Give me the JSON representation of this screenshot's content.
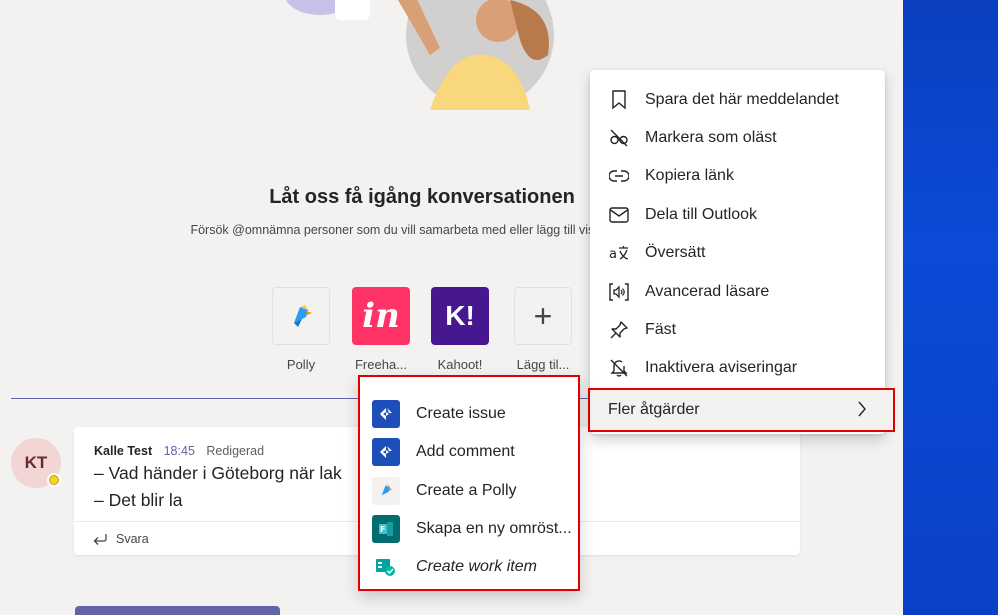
{
  "welcome": {
    "title": "Låt oss få igång konversationen",
    "subtitle": "Försök @omnämna personer som du vill samarbeta med eller lägg till vissa fli"
  },
  "apps": [
    {
      "name": "Polly",
      "icon": "polly-parrot-icon"
    },
    {
      "name": "Freeha...",
      "icon": "invision-icon",
      "glyph": "in",
      "color": "#ff3366"
    },
    {
      "name": "Kahoot!",
      "icon": "kahoot-icon",
      "glyph": "K!",
      "color": "#46178f"
    },
    {
      "name": "Lägg til...",
      "icon": "plus-icon",
      "glyph": "+"
    }
  ],
  "message": {
    "avatar_initials": "KT",
    "author": "Kalle Test",
    "time": "18:45",
    "edited": "Redigerad",
    "lines": [
      "– Vad händer i Göteborg när lak",
      "– Det blir la"
    ],
    "reply_label": "Svara"
  },
  "context_menu": {
    "items": [
      {
        "label": "Spara det här meddelandet",
        "icon": "bookmark-icon"
      },
      {
        "label": "Markera som oläst",
        "icon": "unread-glasses-icon"
      },
      {
        "label": "Kopiera länk",
        "icon": "link-icon"
      },
      {
        "label": "Dela till Outlook",
        "icon": "mail-icon"
      },
      {
        "label": "Översätt",
        "icon": "translate-icon"
      },
      {
        "label": "Avancerad läsare",
        "icon": "immersive-reader-icon"
      },
      {
        "label": "Fäst",
        "icon": "pin-icon"
      },
      {
        "label": "Inaktivera aviseringar",
        "icon": "bell-off-icon"
      }
    ],
    "more_actions": "Fler åtgärder"
  },
  "sub_menu": {
    "items": [
      {
        "label": "Create issue",
        "icon": "jira-icon"
      },
      {
        "label": "Add comment",
        "icon": "jira-icon"
      },
      {
        "label": "Create a Polly",
        "icon": "polly-parrot-icon"
      },
      {
        "label": "Skapa en ny omröst...",
        "icon": "forms-poll-icon"
      },
      {
        "label": "Create work item",
        "icon": "azure-boards-icon"
      }
    ]
  },
  "colors": {
    "accent": "#6264a7",
    "highlight_border": "#e00000",
    "desktop": "#0b4bd6"
  }
}
